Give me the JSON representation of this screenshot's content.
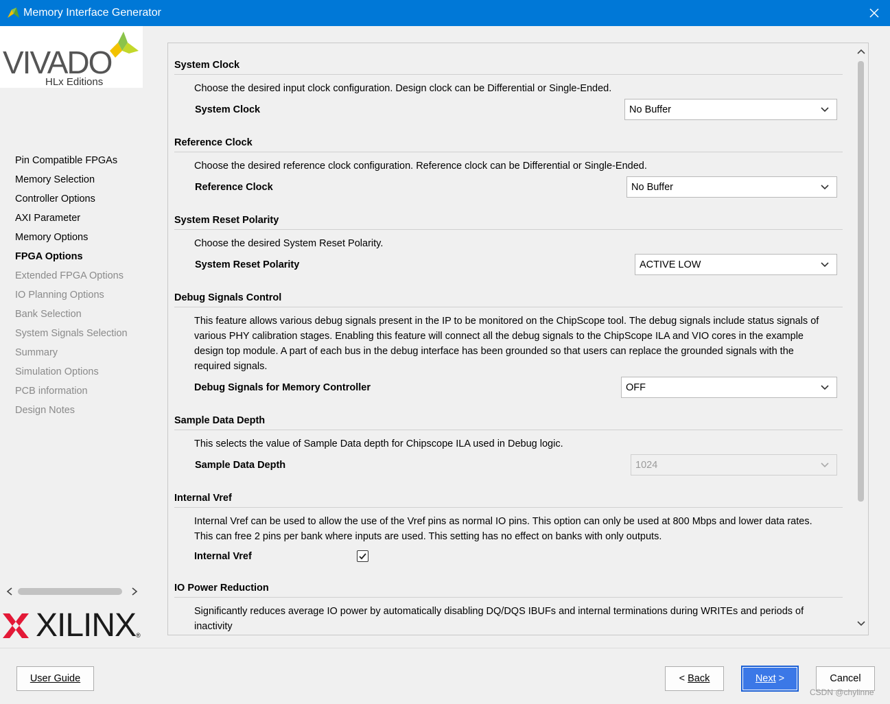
{
  "window": {
    "title": "Memory Interface Generator"
  },
  "logo": {
    "vivado": "VIVADO",
    "hlx": "HLx Editions",
    "xilinx": "XILINX",
    "reg": "®"
  },
  "nav": [
    {
      "label": "Pin Compatible FPGAs",
      "state": "done"
    },
    {
      "label": "Memory Selection",
      "state": "done"
    },
    {
      "label": "Controller Options",
      "state": "done"
    },
    {
      "label": "AXI Parameter",
      "state": "done"
    },
    {
      "label": "Memory Options",
      "state": "done"
    },
    {
      "label": "FPGA Options",
      "state": "active"
    },
    {
      "label": "Extended FPGA Options",
      "state": "pending"
    },
    {
      "label": "IO Planning Options",
      "state": "pending"
    },
    {
      "label": "Bank Selection",
      "state": "pending"
    },
    {
      "label": "System Signals Selection",
      "state": "pending"
    },
    {
      "label": "Summary",
      "state": "pending"
    },
    {
      "label": "Simulation Options",
      "state": "pending"
    },
    {
      "label": "PCB information",
      "state": "pending"
    },
    {
      "label": "Design Notes",
      "state": "pending"
    }
  ],
  "sections": {
    "system_clock": {
      "heading": "System Clock",
      "desc": "Choose the desired input clock configuration. Design clock can be Differential or Single-Ended.",
      "label": "System Clock",
      "value": "No Buffer"
    },
    "reference_clock": {
      "heading": "Reference Clock",
      "desc": "Choose the desired reference clock configuration. Reference clock can be Differential or Single-Ended.",
      "label": "Reference Clock",
      "value": "No Buffer"
    },
    "reset_polarity": {
      "heading": "System Reset Polarity",
      "desc": "Choose the desired System Reset Polarity.",
      "label": "System Reset Polarity",
      "value": "ACTIVE LOW"
    },
    "debug": {
      "heading": "Debug Signals Control",
      "desc1": "This feature allows various debug signals present in the IP to be monitored on the ChipScope tool. The debug signals include status signals of",
      "desc2": "various PHY calibration stages. Enabling this feature will connect all the debug signals to the ChipScope ILA and VIO cores in the example",
      "desc3": "design top module. A part of each bus in the debug interface has been grounded so that users can replace the grounded signals with the",
      "desc4": "required signals.",
      "label": "Debug Signals for Memory Controller",
      "value": "OFF"
    },
    "sample_depth": {
      "heading": "Sample Data Depth",
      "desc": "This selects the value of Sample Data depth for Chipscope ILA used in Debug logic.",
      "label": "Sample Data Depth",
      "value": "1024"
    },
    "internal_vref": {
      "heading": "Internal Vref",
      "desc1": "Internal Vref can be used to allow the use of the Vref pins as normal IO pins. This option can only be used at 800 Mbps and lower data rates.",
      "desc2": "This can free 2 pins per bank where inputs are used. This setting has no effect on banks with only outputs.",
      "label": "Internal Vref",
      "checked": true
    },
    "io_power": {
      "heading": "IO Power Reduction",
      "desc1": "Significantly reduces average IO power by automatically disabling DQ/DQS IBUFs and internal terminations during WRITEs and periods of",
      "desc2": "inactivity"
    }
  },
  "buttons": {
    "user_guide": "User Guide",
    "back_prefix": "< ",
    "back": "Back",
    "next": "Next",
    "next_suffix": " >",
    "cancel": "Cancel"
  },
  "watermark": "CSDN @chylinne",
  "colors": {
    "titlebar": "#0078d7",
    "primary": "#3b78e7"
  }
}
